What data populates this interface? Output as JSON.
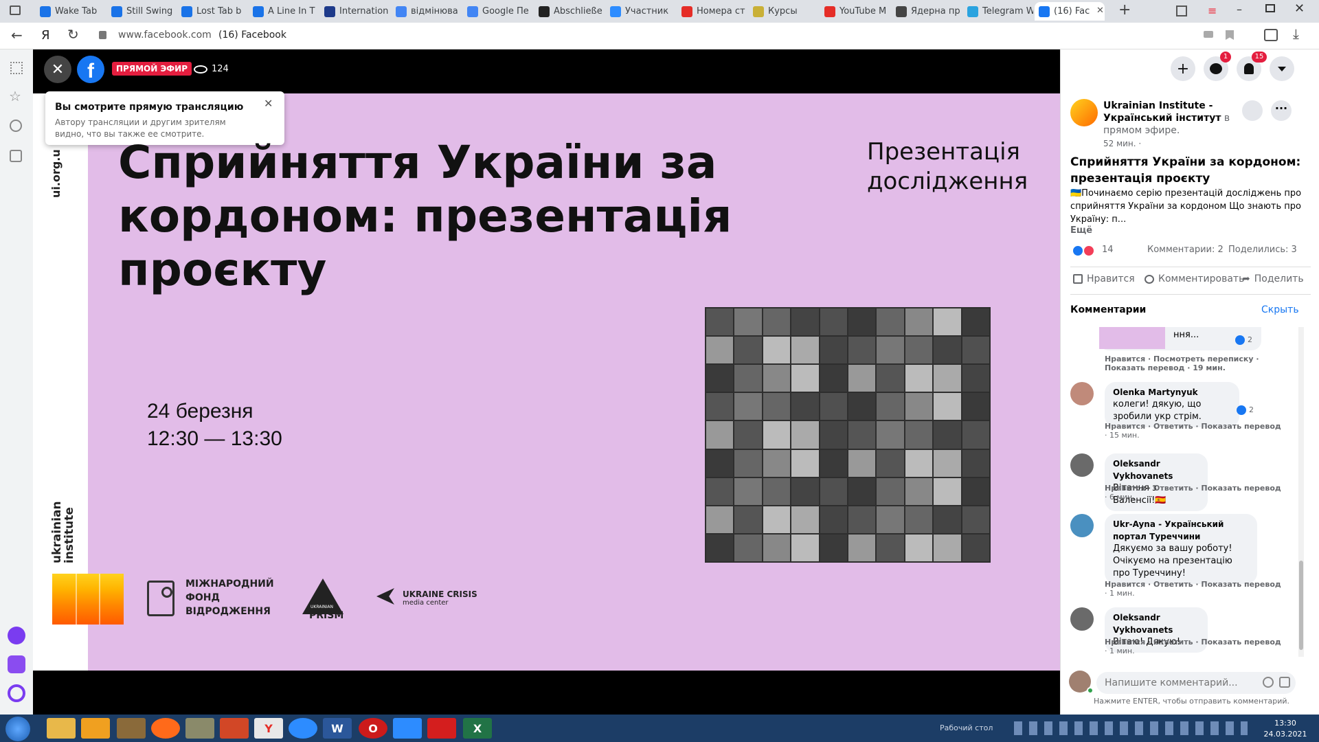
{
  "browser": {
    "tabs": [
      {
        "label": "Wake Tab",
        "color": "#1a73e8"
      },
      {
        "label": "Still Swing",
        "color": "#1a73e8"
      },
      {
        "label": "Lost Tab b",
        "color": "#1a73e8"
      },
      {
        "label": "A Line In T",
        "color": "#1a73e8"
      },
      {
        "label": "Internation",
        "color": "#1e3a8a"
      },
      {
        "label": "відмінюва",
        "color": "#4285f4"
      },
      {
        "label": "Google Пе",
        "color": "#4285f4"
      },
      {
        "label": "Abschließe",
        "color": "#222222"
      },
      {
        "label": "Участник",
        "color": "#2d8cff"
      },
      {
        "label": "Номера ст",
        "color": "#e52d27"
      },
      {
        "label": "Курсы",
        "color": "#c9b037"
      },
      {
        "label": "YouTube М",
        "color": "#e52d27"
      },
      {
        "label": "Ядерна пр",
        "color": "#444444"
      },
      {
        "label": "Telegram W",
        "color": "#2aa3df"
      },
      {
        "label": "(16) Fac",
        "color": "#1877f2"
      }
    ],
    "address_host": "www.facebook.com",
    "address_title": "(16) Facebook",
    "yandex_glyph": "Я"
  },
  "video": {
    "live_badge": "ПРЯМОЙ ЭФИР",
    "viewers": "124",
    "notice_title": "Вы смотрите прямую трансляцию",
    "notice_body": "Автору трансляции и другим зрителям видно, что вы также ее смотрите."
  },
  "slide": {
    "side_url": "ui.org.u",
    "side_logo": "ukrainian institute",
    "title": "Сприйняття України за кордоном: презентація проєкту",
    "subtitle": "Презентація дослідження",
    "date": "24 березня",
    "time": "12:30 — 13:30",
    "partner1": "МІЖНАРОДНИЙ ФОНД ВІДРОДЖЕННЯ",
    "partner2_small": "UKRAINIAN",
    "partner2": "PRISM",
    "partner3": "UKRAINE CRISIS",
    "partner3_sub": "media center"
  },
  "facebook": {
    "messenger_badge": "1",
    "notif_badge": "15",
    "page_name": "Ukrainian Institute - Український інститут",
    "live_text": "в прямом эфире.",
    "time": "52 мин. ·",
    "post_title": "Сприйняття України за кордоном: презентація проєкту",
    "post_text": "🇺🇦Починаємо серію презентацій досліджень про сприйняття України за кордоном Що знають про Україну: п...",
    "more": "Ещё",
    "reactions": "14",
    "comments_count": "Комментарии: 2",
    "shares_count": "Поделились: 3",
    "like": "Нравится",
    "comment": "Комментировать",
    "share": "Поделить",
    "comments_header": "Комментарии",
    "hide": "Скрыть",
    "c0_text": "ння...",
    "c0_count": "2",
    "c0_actions": "Нравится · Посмотреть переписку · Показать перевод · 19 мин.",
    "comments": [
      {
        "name": "Olenka Martynyuk",
        "text": "колеги! дякую, що зробили укр стрім.",
        "actions": "Нравится · Ответить · Показать перевод",
        "time": "· 15 мин.",
        "count": "2"
      },
      {
        "name": "Oleksandr Vykhovanets",
        "text": "Вітання з Валенсії!🇪🇸",
        "actions": "Нравится · Ответить · Показать перевод",
        "time": "· 6 мин.",
        "count": ""
      },
      {
        "name": "Ukr-Ayna - Український портал Туреччини",
        "text": "Дякуємо за вашу роботу! Очікуємо на презентацію про Туреччину!",
        "actions": "Нравится · Ответить · Показать перевод",
        "time": "· 1 мин.",
        "count": ""
      },
      {
        "name": "Oleksandr Vykhovanets",
        "text": "Вітаю! Дякую!",
        "actions": "Нравится · Ответить · Показать перевод",
        "time": "· 1 мин.",
        "count": ""
      }
    ],
    "input_placeholder": "Напишите комментарий...",
    "input_hint": "Нажмите ENTER, чтобы отправить комментарий."
  },
  "taskbar": {
    "desktop_label": "Рабочий стол",
    "clock_time": "13:30",
    "clock_date": "24.03.2021"
  }
}
